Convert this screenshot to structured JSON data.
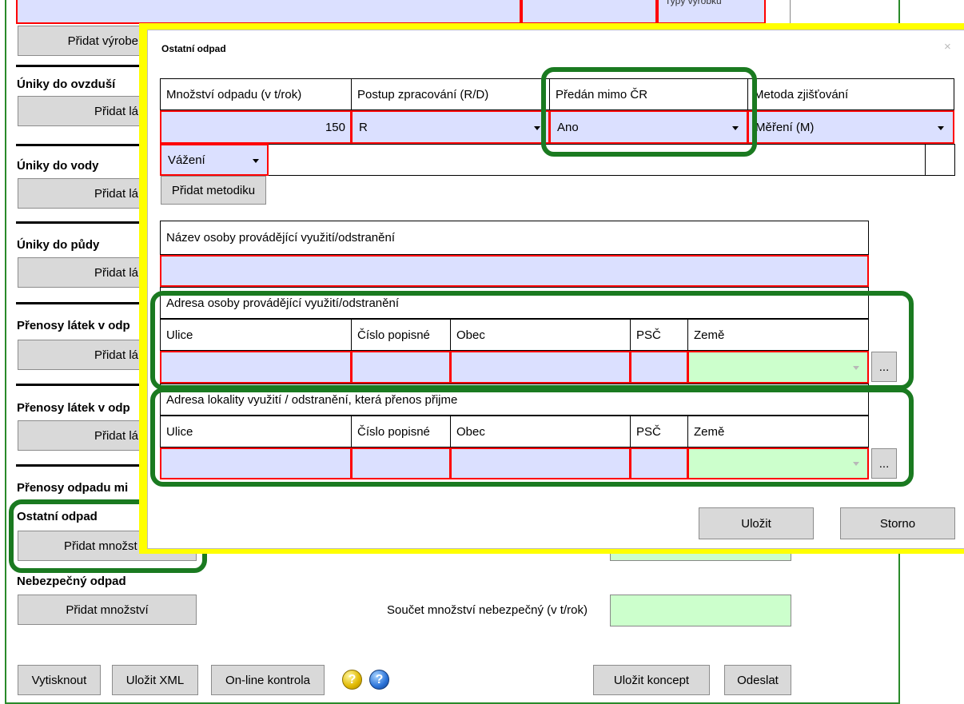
{
  "bg": {
    "add_product_button": "Přidat výrobe",
    "product_select_text": "Typy výrobku",
    "sections": [
      {
        "heading": "Úniky do ovzduší",
        "button": "Přidat lá"
      },
      {
        "heading": "Úniky do vody",
        "button": "Přidat lá"
      },
      {
        "heading": "Úniky do půdy",
        "button": "Přidat lá"
      },
      {
        "heading": "Přenosy látek v odp",
        "button": "Přidat lá"
      },
      {
        "heading": "Přenosy látek v odp",
        "button": "Přidat lá"
      }
    ],
    "transfers_heading": "Přenosy odpadu mi",
    "other_waste_heading": "Ostatní odpad",
    "other_waste_button": "Přidat množst",
    "hazardous_heading": "Nebezpečný odpad",
    "hazardous_button": "Přidat množství",
    "hazardous_sum_label": "Součet množství nebezpečný (v t/rok)",
    "hazardous_sum_value": "",
    "footer": {
      "print": "Vytisknout",
      "save_xml": "Uložit XML",
      "online_check": "On-line kontrola",
      "save_draft": "Uložit koncept",
      "send": "Odeslat"
    }
  },
  "modal": {
    "title": "Ostatní odpad",
    "close": "×",
    "headers": {
      "amount": "Množství odpadu (v t/rok)",
      "procedure": "Postup zpracování (R/D)",
      "abroad": "Předán mimo ČR",
      "method": "Metoda zjišťování"
    },
    "values": {
      "amount": "150",
      "procedure": "R",
      "abroad": "Ano",
      "method": "Měření (M)",
      "methodology": "Vážení"
    },
    "add_methodology": "Přidat metodiku",
    "person_name_label": "Název osoby provádějící využití/odstranění",
    "person_name_value": "",
    "address_person": {
      "title": "Adresa osoby provádějící využití/odstranění",
      "street": "Ulice",
      "number": "Číslo popisné",
      "city": "Obec",
      "zip": "PSČ",
      "country": "Země",
      "more": "..."
    },
    "address_site": {
      "title": "Adresa lokality využití / odstranění, která přenos přijme",
      "street": "Ulice",
      "number": "Číslo popisné",
      "city": "Obec",
      "zip": "PSČ",
      "country": "Země",
      "more": "..."
    },
    "save": "Uložit",
    "cancel": "Storno"
  },
  "colors": {
    "input_bg": "#dbe0ff",
    "country_bg": "#ccffcc",
    "error_border": "#ff0000",
    "highlight_ring": "#1a7a20",
    "modal_highlight": "#ffff00"
  }
}
